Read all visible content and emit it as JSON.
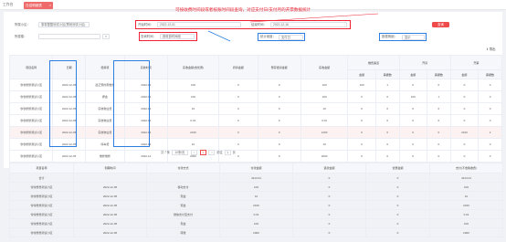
{
  "tabs": {
    "home": "工作台",
    "active": "日结明细表"
  },
  "annotation": "可按收费时间段或者核账时间段查询，对应支付日/支付月的开票数据统计",
  "filters": {
    "project_label": "所属小区：",
    "project_value": "零零整整测试小区(预测测试小区)",
    "start_label": "开始时间：",
    "start_value": "2022-12-01",
    "end_label": "结束时间：",
    "end_value": "2022-12-16",
    "second_label": "所属楼：",
    "second_value": "",
    "type_label": "查询时间：",
    "type_value": "按收费时间段",
    "stat_label": "统计维度：",
    "stat_value": "支付日",
    "summary_label": "数据明细：",
    "summary_value": "显示",
    "query_button": "查询",
    "export_label": "导出"
  },
  "table1": {
    "headers": [
      "项目名称",
      "日期",
      "费用项",
      "实收时间",
      "实收金额(含优惠)",
      "折扣金额",
      "预存抵扣金额",
      "实收金额",
      "缴费渠道",
      "开具",
      "开票"
    ],
    "sub_headers": [
      "金额",
      "票据数",
      "金额",
      "票据数",
      "金额",
      "票据数"
    ],
    "rows": [
      [
        "零零整整测试小区",
        "2022-12-05",
        "晨正预约家缴费",
        "2022-12",
        "100",
        "0",
        "0",
        "100",
        "100",
        "1",
        "0",
        "0",
        "0",
        "0"
      ],
      [
        "零零整整测试小区",
        "2022-12-05",
        "押金",
        "2022-12",
        "100",
        "0",
        "0",
        "100",
        "0",
        "0",
        "100",
        "1",
        "0",
        "0"
      ],
      [
        "零零整整测试小区",
        "2022-12-05",
        "实收物业费",
        "2022-12",
        "10",
        "0",
        "0",
        "10",
        "0",
        "0",
        "0",
        "0",
        "0",
        "0"
      ],
      [
        "零零整整测试小区",
        "2022-12-05",
        "实收物业费",
        "2022-12",
        "0.01",
        "0",
        "0",
        "0.01",
        "0",
        "0",
        "0",
        "0",
        "0",
        "0"
      ],
      [
        "零零整整测试小区",
        "2022-12-05",
        "实收物业费",
        "2022-12",
        "2160",
        "0",
        "0",
        "2160",
        "0",
        "0",
        "0",
        "0",
        "2160",
        "2"
      ],
      [
        "零零整整测试小区",
        "2022-12-05",
        "停车费",
        "2022-12",
        "10",
        "0",
        "0",
        "10",
        "0",
        "0",
        "0",
        "0",
        "0",
        "0"
      ],
      [
        "零零整整测试小区",
        "2022-12-05",
        "维修维修",
        "2022-12",
        "2000",
        "0",
        "0",
        "2000",
        "0",
        "0",
        "0",
        "0",
        "0",
        "0"
      ]
    ],
    "pager": {
      "total": "共 7 条",
      "page_size": "10条/页",
      "current": "1",
      "goto_label": "前往",
      "goto_value": "1",
      "page_unit": "页"
    }
  },
  "table2": {
    "headers": [
      "项目名称",
      "到期时间",
      "付款方式",
      "付款金额",
      "退款金额",
      "优惠金额",
      "支付(不含税收费)"
    ],
    "total_row": [
      "合计",
      "",
      "",
      "4413.01",
      "0",
      "0",
      "4413.01"
    ],
    "rows": [
      [
        "零零整整测试小区",
        "2022-12-05",
        "移动支付",
        "100",
        "0",
        "0",
        "100"
      ],
      [
        "零零整整测试小区",
        "2022-12-05",
        "现金",
        "10",
        "0",
        "0",
        "10"
      ],
      [
        "零零整整测试小区",
        "2022-12-05",
        "现金",
        "2160",
        "0",
        "0",
        "2160"
      ],
      [
        "零零整整测试小区",
        "2022-12-05",
        "微信支付宝支付",
        "0.01",
        "0",
        "0",
        "0.01"
      ],
      [
        "零零整整测试小区",
        "2022-12-05",
        "现金",
        "100",
        "0",
        "0",
        "100"
      ],
      [
        "零零整整测试小区",
        "2022-12-05",
        "转账",
        "2000",
        "0",
        "0",
        "2000"
      ]
    ]
  },
  "colors": {
    "accent": "#ef4b4b",
    "annotation": "#e23",
    "highlight": "#2d7ee0"
  }
}
